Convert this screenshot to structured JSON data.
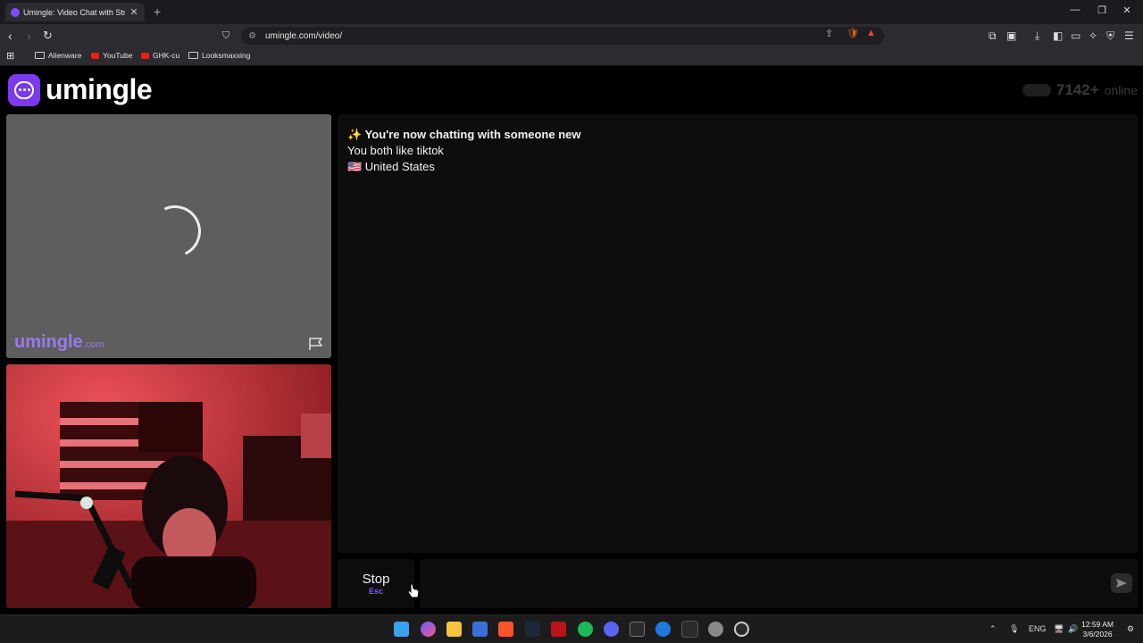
{
  "browser": {
    "tab_title": "Umingle: Video Chat with Str",
    "url": "umingle.com/video/",
    "bookmarks": [
      "Alienware",
      "YouTube",
      "GHK-cu",
      "Looksmaxxing"
    ]
  },
  "header": {
    "logo_text": "umingle",
    "online_count": "7142+",
    "online_label": "online"
  },
  "stranger_video": {
    "watermark": "umingle",
    "watermark_suffix": ".com"
  },
  "chat": {
    "messages": [
      "✨ You're now chatting with someone new",
      "You both like tiktok",
      "🇺🇸 United States"
    ]
  },
  "controls": {
    "stop_label": "Stop",
    "stop_key": "Esc"
  },
  "taskbar": {
    "language": "ENG",
    "time": "12:59 AM",
    "date": "3/6/2026"
  },
  "colors": {
    "brand": "#7c3aed",
    "background": "#000000"
  }
}
